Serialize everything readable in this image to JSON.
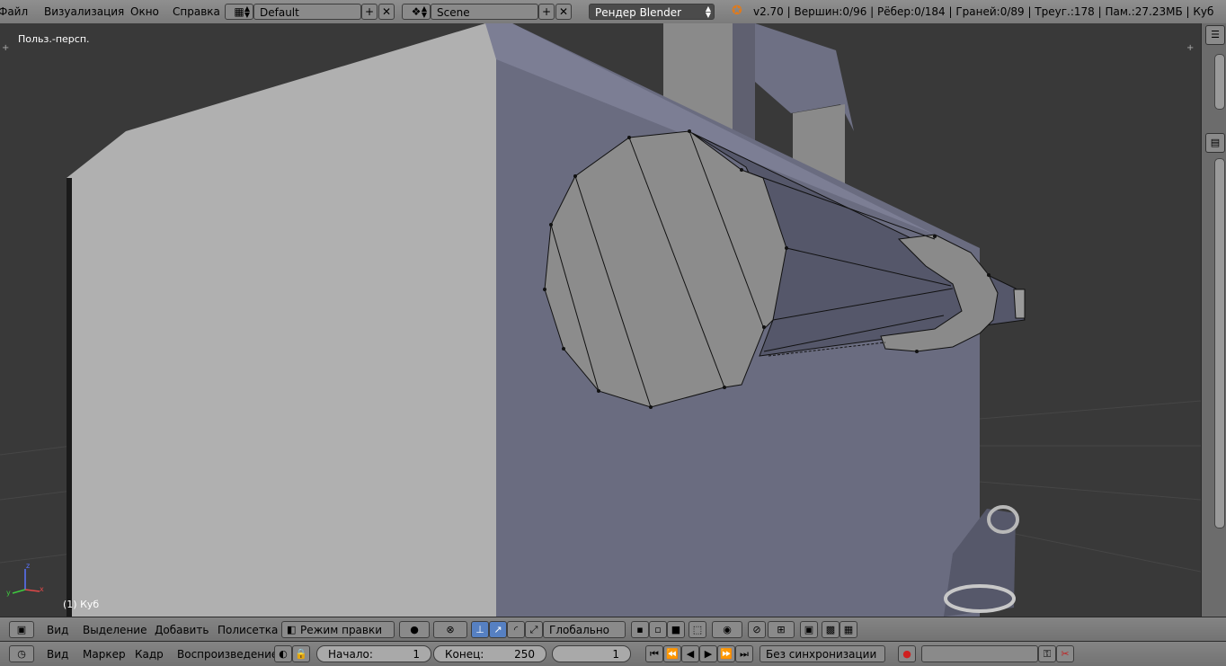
{
  "menubar": {
    "items": [
      "Файл",
      "Визуализация",
      "Окно",
      "Справка"
    ],
    "layout": "Default",
    "scene": "Scene",
    "engine": "Рендер Blender",
    "stats": "v2.70 | Вершин:0/96 | Рёбер:0/184 | Граней:0/89 | Треуг.:178 | Пам.:27.23МБ | Куб"
  },
  "viewport": {
    "view_name": "Польз.-персп.",
    "object_name": "(1) Куб"
  },
  "view_header": {
    "menus": [
      "Вид",
      "Выделение",
      "Добавить",
      "Полисетка"
    ],
    "mode": "Режим правки",
    "orientation": "Глобально"
  },
  "timeline": {
    "menus": [
      "Вид",
      "Маркер",
      "Кадр",
      "Воспроизведение"
    ],
    "start_label": "Начало:",
    "start_value": "1",
    "end_label": "Конец:",
    "end_value": "250",
    "current_frame": "1",
    "sync": "Без синхронизации"
  },
  "colors": {
    "header": "#808080",
    "viewport_bg": "#393939",
    "face_light": "#b0b0b0",
    "face_blue": "#6a6c80",
    "accent": "#5680c2"
  }
}
